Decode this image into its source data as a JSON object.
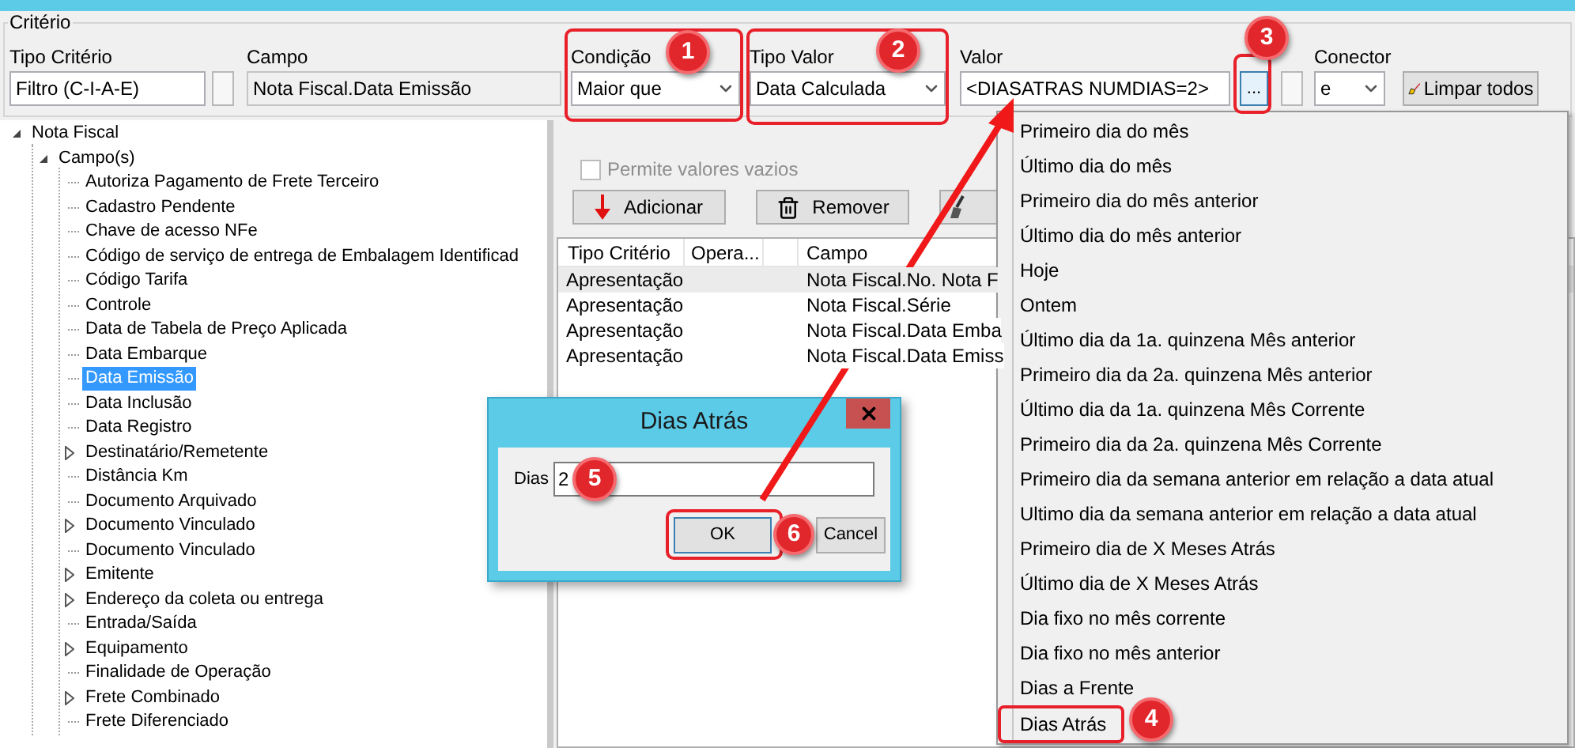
{
  "criteria": {
    "title": "Critério",
    "tipo_criterio": {
      "label": "Tipo Critério",
      "value": "Filtro (C-I-A-E)"
    },
    "tipo_checkbox": {
      "checked": false
    },
    "campo": {
      "label": "Campo",
      "value": "Nota Fiscal.Data Emissão"
    },
    "condicao": {
      "label": "Condição",
      "value": "Maior que"
    },
    "tipo_valor": {
      "label": "Tipo Valor",
      "value": "Data Calculada"
    },
    "valor": {
      "label": "Valor",
      "value": "<DIASATRAS NUMDIAS=2>",
      "button": "..."
    },
    "conector_checkbox": {
      "checked": false
    },
    "conector": {
      "label": "Conector",
      "value": "e"
    },
    "clear_button": "Limpar todos"
  },
  "tree": [
    {
      "label": "Nota Fiscal",
      "kind": "branch",
      "expanded": true,
      "selected": false,
      "children": [
        {
          "label": "Campo(s)",
          "kind": "branch",
          "expanded": true,
          "selected": false,
          "children": [
            {
              "label": "Autoriza Pagamento de Frete Terceiro",
              "kind": "leaf",
              "selected": false
            },
            {
              "label": "Cadastro Pendente",
              "kind": "leaf",
              "selected": false
            },
            {
              "label": "Chave de acesso NFe",
              "kind": "leaf",
              "selected": false
            },
            {
              "label": "Código de serviço de entrega de Embalagem Identificad",
              "kind": "leaf",
              "selected": false
            },
            {
              "label": "Código Tarifa",
              "kind": "leaf",
              "selected": false
            },
            {
              "label": "Controle",
              "kind": "leaf",
              "selected": false
            },
            {
              "label": "Data de Tabela de Preço Aplicada",
              "kind": "leaf",
              "selected": false
            },
            {
              "label": "Data Embarque",
              "kind": "leaf",
              "selected": false
            },
            {
              "label": "Data Emissão",
              "kind": "leaf",
              "selected": true
            },
            {
              "label": "Data Inclusão",
              "kind": "leaf",
              "selected": false
            },
            {
              "label": "Data Registro",
              "kind": "leaf",
              "selected": false
            },
            {
              "label": "Destinatário/Remetente",
              "kind": "branch",
              "expanded": false,
              "selected": false
            },
            {
              "label": "Distância Km",
              "kind": "leaf",
              "selected": false
            },
            {
              "label": "Documento Arquivado",
              "kind": "leaf",
              "selected": false
            },
            {
              "label": "Documento Vinculado",
              "kind": "branch",
              "expanded": false,
              "selected": false
            },
            {
              "label": "Documento Vinculado",
              "kind": "leaf",
              "selected": false
            },
            {
              "label": "Emitente",
              "kind": "branch",
              "expanded": false,
              "selected": false
            },
            {
              "label": "Endereço da coleta ou entrega",
              "kind": "branch",
              "expanded": false,
              "selected": false
            },
            {
              "label": "Entrada/Saída",
              "kind": "leaf",
              "selected": false
            },
            {
              "label": "Equipamento",
              "kind": "branch",
              "expanded": false,
              "selected": false
            },
            {
              "label": "Finalidade de Operação",
              "kind": "leaf",
              "selected": false
            },
            {
              "label": "Frete Combinado",
              "kind": "branch",
              "expanded": false,
              "selected": false
            },
            {
              "label": "Frete Diferenciado",
              "kind": "leaf",
              "selected": false
            }
          ]
        }
      ]
    }
  ],
  "allow_empty": {
    "label": "Permite valores vazios",
    "checked": false,
    "disabled": true
  },
  "actions": [
    {
      "label": "Adicionar",
      "kind": "add"
    },
    {
      "label": "Remover",
      "kind": "remove"
    }
  ],
  "table": {
    "columns": [
      {
        "label": "Tipo Critério"
      },
      {
        "label": "Opera..."
      },
      {
        "label": "Campo"
      }
    ],
    "rows": [
      {
        "tipo": "Apresentação",
        "campo": "Nota Fiscal.No. Nota F",
        "selected": true
      },
      {
        "tipo": "Apresentação",
        "campo": "Nota Fiscal.Série",
        "selected": false
      },
      {
        "tipo": "Apresentação",
        "campo": "Nota Fiscal.Data Emba",
        "selected": false
      },
      {
        "tipo": "Apresentação",
        "campo": "Nota Fiscal.Data Emiss",
        "selected": false
      }
    ]
  },
  "menu": {
    "items": [
      {
        "label": "Primeiro dia do mês",
        "highlighted": false
      },
      {
        "label": "Último dia do mês",
        "highlighted": false
      },
      {
        "label": "Primeiro dia do mês anterior",
        "highlighted": false
      },
      {
        "label": "Último dia do mês anterior",
        "highlighted": false
      },
      {
        "label": "Hoje",
        "highlighted": false
      },
      {
        "label": "Ontem",
        "highlighted": false
      },
      {
        "label": "Último dia da 1a. quinzena Mês anterior",
        "highlighted": false
      },
      {
        "label": "Primeiro dia da 2a. quinzena Mês anterior",
        "highlighted": false
      },
      {
        "label": "Último dia da 1a. quinzena Mês Corrente",
        "highlighted": false
      },
      {
        "label": "Primeiro dia da 2a. quinzena Mês Corrente",
        "highlighted": false
      },
      {
        "label": "Primeiro dia da semana anterior em relação a data atual",
        "highlighted": false
      },
      {
        "label": "Ultimo dia da semana anterior em relação a data atual",
        "highlighted": false
      },
      {
        "label": "Primeiro dia de X Meses Atrás",
        "highlighted": false
      },
      {
        "label": "Último dia de X Meses Atrás",
        "highlighted": false
      },
      {
        "label": "Dia fixo no mês corrente",
        "highlighted": false
      },
      {
        "label": "Dia fixo no mês anterior",
        "highlighted": false
      },
      {
        "label": "Dias a Frente",
        "highlighted": false
      },
      {
        "label": "Dias Atrás",
        "highlighted": true
      }
    ]
  },
  "dialog": {
    "title": "Dias Atrás",
    "field_label": "Dias",
    "value": "2",
    "buttons": [
      "OK",
      "Cancel"
    ]
  },
  "callouts": [
    "1",
    "2",
    "3",
    "4",
    "5",
    "6"
  ]
}
